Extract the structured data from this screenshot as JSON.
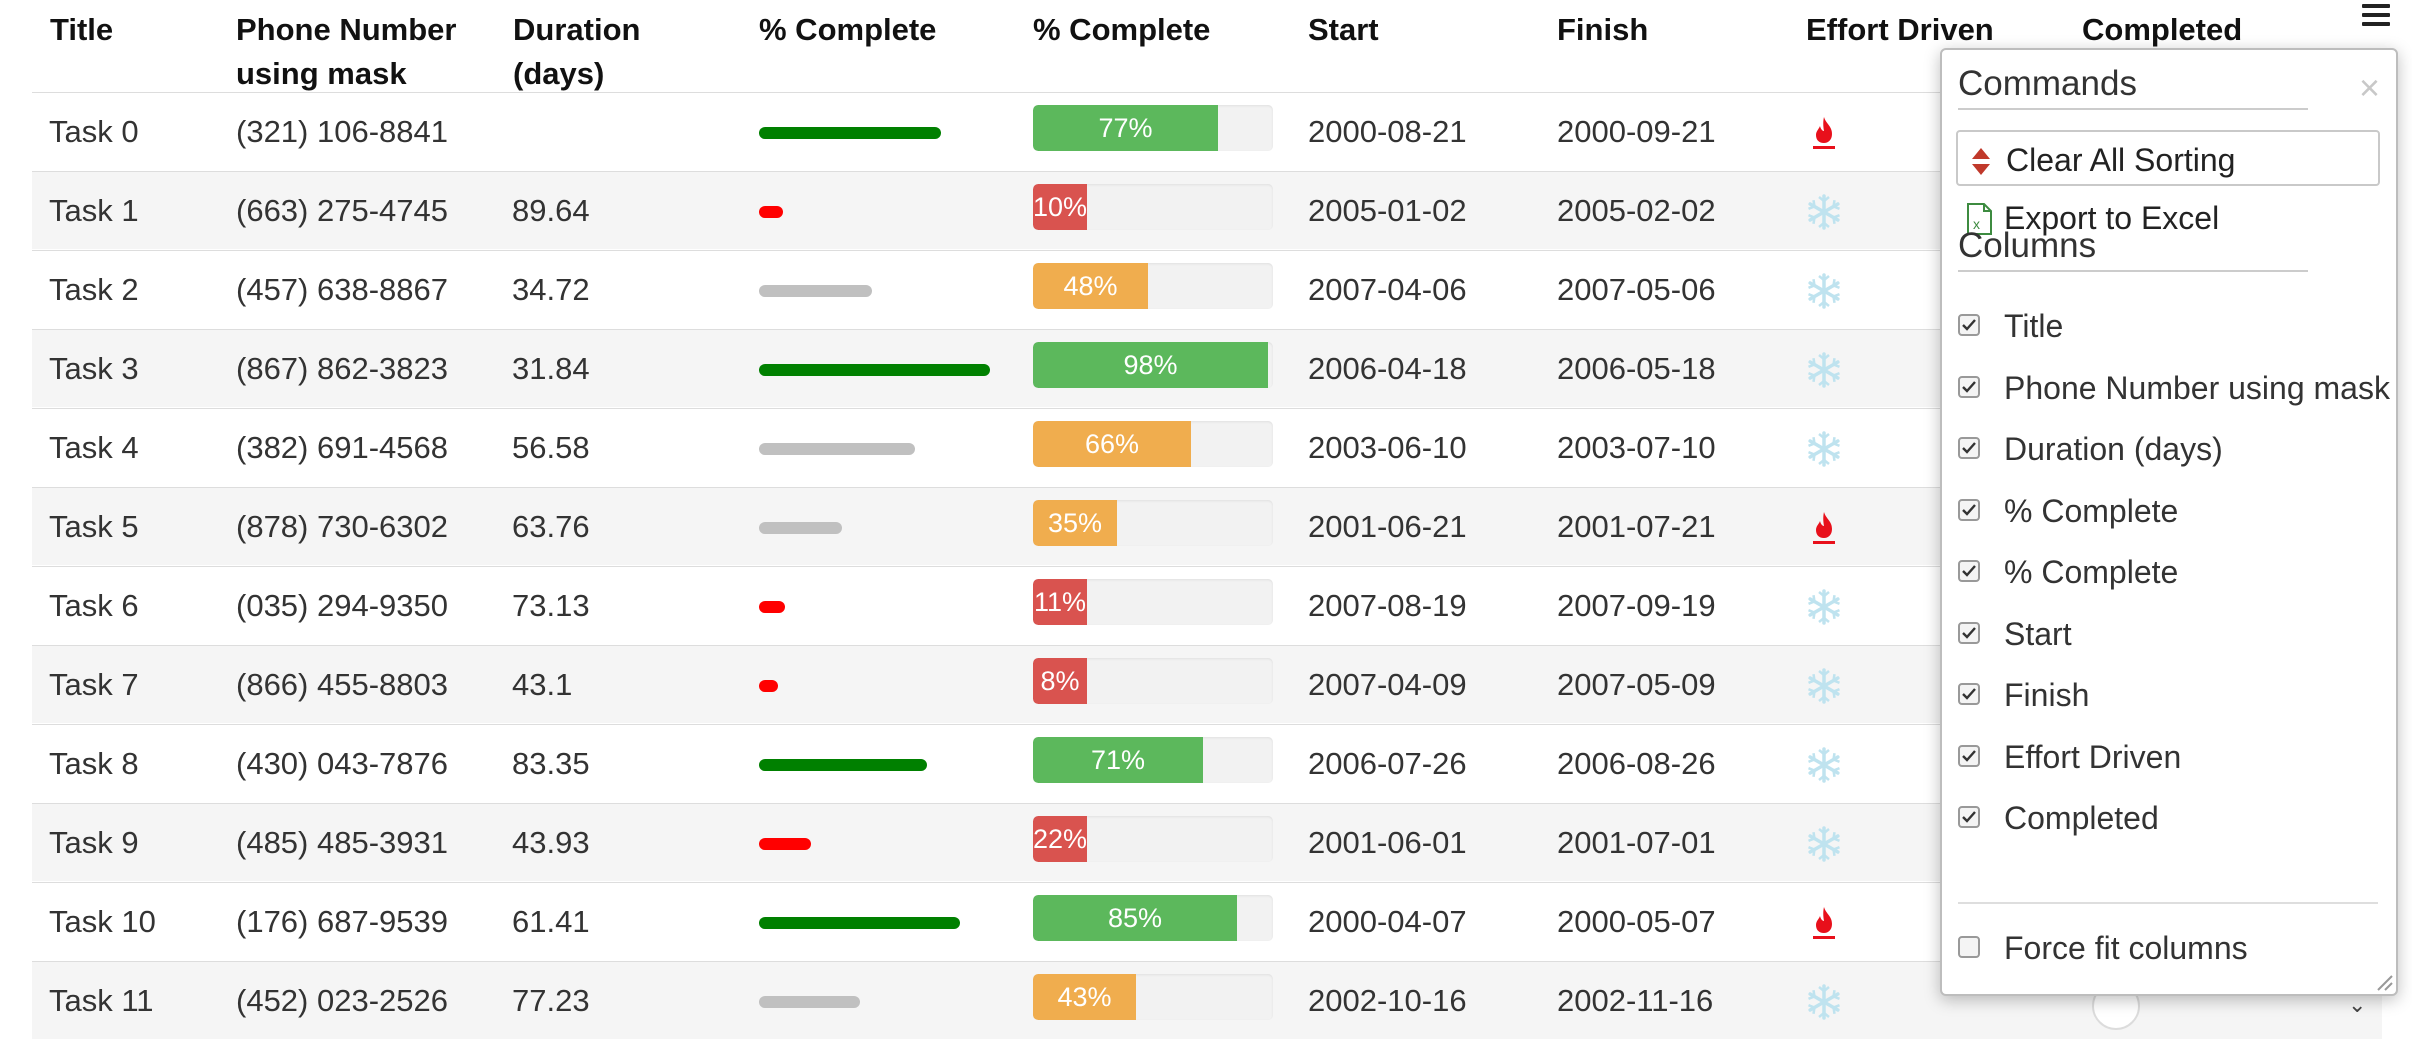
{
  "columns": [
    "Title",
    "Phone Number using mask",
    "Duration (days)",
    "% Complete",
    "% Complete",
    "Start",
    "Finish",
    "Effort Driven",
    "Completed"
  ],
  "header_lines": {
    "title": "Title",
    "phone_1": "Phone Number",
    "phone_2": "using mask",
    "duration_1": "Duration",
    "duration_2": "(days)",
    "pct1": "% Complete",
    "pct2": "% Complete",
    "start": "Start",
    "finish": "Finish",
    "effort": "Effort Driven",
    "completed": "Completed"
  },
  "menu_icon": "hamburger-menu-icon",
  "colors": {
    "green": "#008000",
    "red": "#ff0000",
    "grey": "#c0c0c0",
    "success": "#5cb85c",
    "warning": "#f0ad4e",
    "danger": "#d9534f",
    "flame": "#e8101b",
    "snowflake": "#bfe3ef"
  },
  "rows": [
    {
      "title": "Task 0",
      "phone": "(321) 106-8841",
      "duration": "",
      "pct": 77,
      "pct_label": "77%",
      "start": "2000-08-21",
      "finish": "2000-09-21",
      "effort": "fire"
    },
    {
      "title": "Task 1",
      "phone": "(663) 275-4745",
      "duration": "89.64",
      "pct": 10,
      "pct_label": "10%",
      "start": "2005-01-02",
      "finish": "2005-02-02",
      "effort": "snowflake"
    },
    {
      "title": "Task 2",
      "phone": "(457) 638-8867",
      "duration": "34.72",
      "pct": 48,
      "pct_label": "48%",
      "start": "2007-04-06",
      "finish": "2007-05-06",
      "effort": "snowflake"
    },
    {
      "title": "Task 3",
      "phone": "(867) 862-3823",
      "duration": "31.84",
      "pct": 98,
      "pct_label": "98%",
      "start": "2006-04-18",
      "finish": "2006-05-18",
      "effort": "snowflake"
    },
    {
      "title": "Task 4",
      "phone": "(382) 691-4568",
      "duration": "56.58",
      "pct": 66,
      "pct_label": "66%",
      "start": "2003-06-10",
      "finish": "2003-07-10",
      "effort": "snowflake"
    },
    {
      "title": "Task 5",
      "phone": "(878) 730-6302",
      "duration": "63.76",
      "pct": 35,
      "pct_label": "35%",
      "start": "2001-06-21",
      "finish": "2001-07-21",
      "effort": "fire"
    },
    {
      "title": "Task 6",
      "phone": "(035) 294-9350",
      "duration": "73.13",
      "pct": 11,
      "pct_label": "11%",
      "start": "2007-08-19",
      "finish": "2007-09-19",
      "effort": "snowflake"
    },
    {
      "title": "Task 7",
      "phone": "(866) 455-8803",
      "duration": "43.1",
      "pct": 8,
      "pct_label": "8%",
      "start": "2007-04-09",
      "finish": "2007-05-09",
      "effort": "snowflake"
    },
    {
      "title": "Task 8",
      "phone": "(430) 043-7876",
      "duration": "83.35",
      "pct": 71,
      "pct_label": "71%",
      "start": "2006-07-26",
      "finish": "2006-08-26",
      "effort": "snowflake"
    },
    {
      "title": "Task 9",
      "phone": "(485) 485-3931",
      "duration": "43.93",
      "pct": 22,
      "pct_label": "22%",
      "start": "2001-06-01",
      "finish": "2001-07-01",
      "effort": "snowflake"
    },
    {
      "title": "Task 10",
      "phone": "(176) 687-9539",
      "duration": "61.41",
      "pct": 85,
      "pct_label": "85%",
      "start": "2000-04-07",
      "finish": "2000-05-07",
      "effort": "fire"
    },
    {
      "title": "Task 11",
      "phone": "(452) 023-2526",
      "duration": "77.23",
      "pct": 43,
      "pct_label": "43%",
      "start": "2002-10-16",
      "finish": "2002-11-16",
      "effort": "snowflake"
    }
  ],
  "panel": {
    "commands_title": "Commands",
    "close": "×",
    "commands": [
      {
        "label": "Clear All Sorting",
        "icon": "sort-arrows-icon"
      },
      {
        "label": "Export to Excel",
        "icon": "excel-icon"
      }
    ],
    "columns_title": "Columns",
    "column_items": [
      {
        "label": "Title",
        "checked": true
      },
      {
        "label": "Phone Number using mask",
        "checked": true
      },
      {
        "label": "Duration (days)",
        "checked": true
      },
      {
        "label": "% Complete",
        "checked": true
      },
      {
        "label": "% Complete",
        "checked": true
      },
      {
        "label": "Start",
        "checked": true
      },
      {
        "label": "Finish",
        "checked": true
      },
      {
        "label": "Effort Driven",
        "checked": true
      },
      {
        "label": "Completed",
        "checked": true
      }
    ],
    "force_fit": {
      "label": "Force fit columns",
      "checked": false
    }
  }
}
